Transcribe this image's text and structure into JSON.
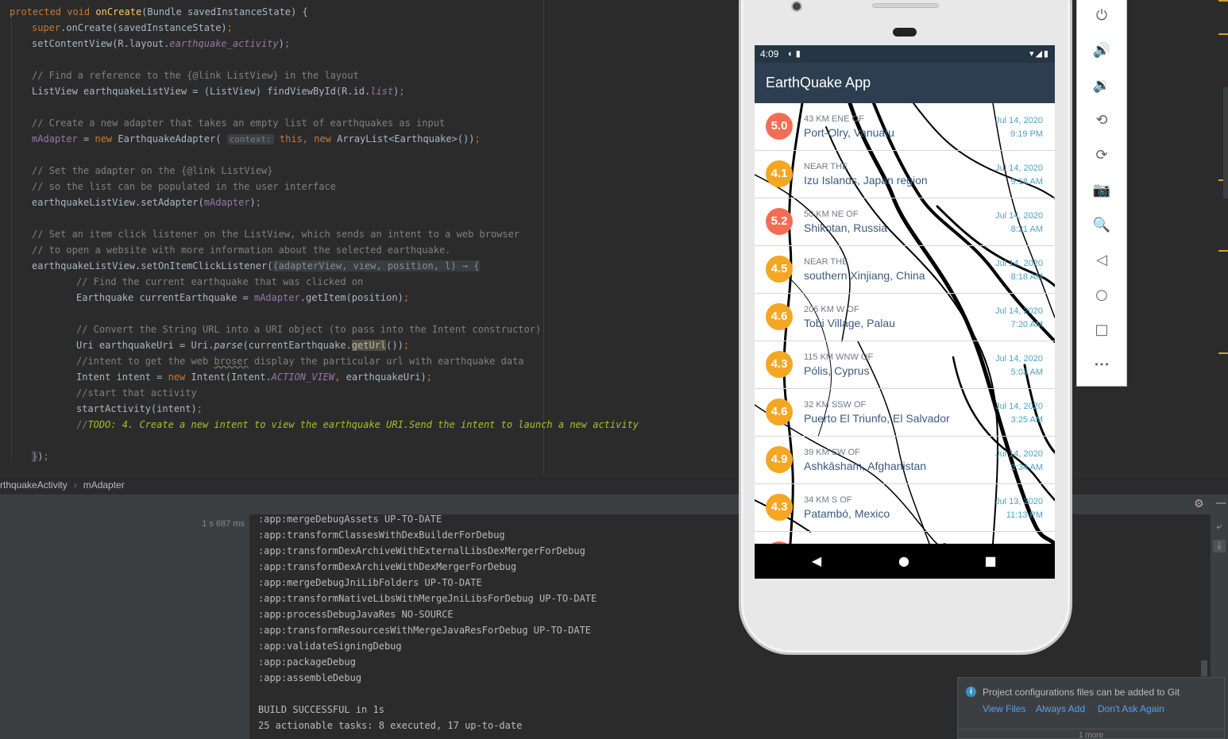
{
  "editor": {
    "lines": [
      {
        "indent": 0,
        "parts": [
          [
            "kw",
            "protected void "
          ],
          [
            "fn",
            "onCreate"
          ],
          [
            "",
            "(Bundle savedInstanceState) {"
          ]
        ]
      },
      {
        "indent": 1,
        "parts": [
          [
            "kw",
            "super"
          ],
          [
            "",
            ".onCreate(savedInstanceState)"
          ],
          [
            "kw",
            ";"
          ]
        ]
      },
      {
        "indent": 1,
        "parts": [
          [
            "",
            "setContentView(R.layout."
          ],
          [
            "fld ital",
            "earthquake_activity"
          ],
          [
            "",
            ")"
          ],
          [
            "kw",
            ";"
          ]
        ]
      },
      {
        "indent": 0,
        "parts": []
      },
      {
        "indent": 1,
        "parts": [
          [
            "cm",
            "// Find a reference to the {@link ListView} in the layout"
          ]
        ]
      },
      {
        "indent": 1,
        "parts": [
          [
            "",
            "ListView earthquakeListView = (ListView) findViewById(R.id."
          ],
          [
            "fld ital",
            "list"
          ],
          [
            "",
            ")"
          ],
          [
            "kw",
            ";"
          ]
        ]
      },
      {
        "indent": 0,
        "parts": []
      },
      {
        "indent": 1,
        "parts": [
          [
            "cm",
            "// Create a new adapter that takes an empty list of earthquakes as input"
          ]
        ]
      },
      {
        "indent": 1,
        "parts": [
          [
            "fld",
            "mAdapter"
          ],
          [
            "",
            " = "
          ],
          [
            "kw",
            "new "
          ],
          [
            "",
            "EarthquakeAdapter( "
          ],
          [
            "hint",
            "context:"
          ],
          [
            "kw",
            " this"
          ],
          [
            "kw",
            ", new "
          ],
          [
            "",
            "ArrayList<Earthquake>())"
          ],
          [
            "kw",
            ";"
          ]
        ]
      },
      {
        "indent": 0,
        "parts": []
      },
      {
        "indent": 1,
        "parts": [
          [
            "cm",
            "// Set the adapter on the {@link ListView}"
          ]
        ]
      },
      {
        "indent": 1,
        "parts": [
          [
            "cm",
            "// so the list can be populated in the user interface"
          ]
        ]
      },
      {
        "indent": 1,
        "parts": [
          [
            "",
            "earthquakeListView.setAdapter("
          ],
          [
            "fld",
            "mAdapter"
          ],
          [
            "",
            ")"
          ],
          [
            "kw",
            ";"
          ]
        ]
      },
      {
        "indent": 0,
        "parts": []
      },
      {
        "indent": 1,
        "parts": [
          [
            "cm",
            "// Set an item click listener on the ListView, which sends an intent to a web browser"
          ]
        ]
      },
      {
        "indent": 1,
        "parts": [
          [
            "cm",
            "// to open a website with more information about the selected earthquake."
          ]
        ]
      },
      {
        "indent": 1,
        "parts": [
          [
            "",
            "earthquakeListView.setOnItemClickListener("
          ],
          [
            "lam",
            "(adapterView, view, position, l) → {"
          ]
        ]
      },
      {
        "indent": 2,
        "parts": [
          [
            "cm",
            "// Find the current earthquake that was clicked on"
          ]
        ]
      },
      {
        "indent": 2,
        "parts": [
          [
            "",
            "Earthquake currentEarthquake = "
          ],
          [
            "fld",
            "mAdapter"
          ],
          [
            "",
            ".getItem(position)"
          ],
          [
            "kw",
            ";"
          ]
        ]
      },
      {
        "indent": 0,
        "parts": []
      },
      {
        "indent": 2,
        "parts": [
          [
            "cm",
            "// Convert the String URL into a URI object (to pass into the Intent constructor)"
          ]
        ]
      },
      {
        "indent": 2,
        "parts": [
          [
            "",
            "Uri earthquakeUri = Uri."
          ],
          [
            "ital",
            "parse"
          ],
          [
            "",
            "(currentEarthquake."
          ],
          [
            "hl",
            "getUrl"
          ],
          [
            "",
            "())"
          ],
          [
            "kw",
            ";"
          ]
        ]
      },
      {
        "indent": 2,
        "parts": [
          [
            "cm",
            "//intent to get the web "
          ],
          [
            "cm squig",
            "broser"
          ],
          [
            "cm",
            " display the particular url with earthquake data"
          ]
        ]
      },
      {
        "indent": 2,
        "parts": [
          [
            "",
            "Intent intent = "
          ],
          [
            "kw",
            "new "
          ],
          [
            "",
            "Intent(Intent."
          ],
          [
            "fld ital",
            "ACTION_VIEW"
          ],
          [
            "kw",
            ", "
          ],
          [
            "",
            "earthquakeUri)"
          ],
          [
            "kw",
            ";"
          ]
        ]
      },
      {
        "indent": 2,
        "parts": [
          [
            "cm",
            "//start that activity"
          ]
        ]
      },
      {
        "indent": 2,
        "parts": [
          [
            "",
            "startActivity(intent)"
          ],
          [
            "kw",
            ";"
          ]
        ]
      },
      {
        "indent": 2,
        "parts": [
          [
            "cm",
            "//"
          ],
          [
            "todo",
            "TODO: 4. Create a new intent to view the earthquake URI.Send the intent to launch a new activity"
          ]
        ]
      },
      {
        "indent": 0,
        "parts": []
      },
      {
        "indent": 1,
        "parts": [
          [
            "lam",
            "}"
          ],
          [
            "",
            ")"
          ],
          [
            "kw",
            ";"
          ]
        ]
      }
    ]
  },
  "breadcrumb": {
    "class_name": "rthquakeActivity",
    "separator": "›",
    "member": "mAdapter"
  },
  "build": {
    "elapsed": "1 s 687 ms",
    "output": [
      ":app:mergeDebugAssets UP-TO-DATE",
      ":app:transformClassesWithDexBuilderForDebug",
      ":app:transformDexArchiveWithExternalLibsDexMergerForDebug",
      ":app:transformDexArchiveWithDexMergerForDebug",
      ":app:mergeDebugJniLibFolders UP-TO-DATE",
      ":app:transformNativeLibsWithMergeJniLibsForDebug UP-TO-DATE",
      ":app:processDebugJavaRes NO-SOURCE",
      ":app:transformResourcesWithMergeJavaResForDebug UP-TO-DATE",
      ":app:validateSigningDebug",
      ":app:packageDebug",
      ":app:assembleDebug",
      "",
      "BUILD SUCCESSFUL in 1s",
      "25 actionable tasks: 8 executed, 17 up-to-date"
    ],
    "gear_icon": "⚙",
    "minimize_icon": "—"
  },
  "phone": {
    "status_time": "4:09",
    "status_left_icons": "◐ ▮",
    "status_right_icons": "▾◢▮",
    "app_title": "EarthQuake App",
    "quakes": [
      {
        "mag": "5.0",
        "color": "#f16e55",
        "offset": "43 KM ENE OF",
        "place": "Port-Olry, Vanuatu",
        "date": "Jul 14, 2020",
        "time": "9:19 PM"
      },
      {
        "mag": "4.1",
        "color": "#f5a623",
        "offset": "NEAR THE",
        "place": "Izu Islands, Japan region",
        "date": "Jul 14, 2020",
        "time": "9:18 AM"
      },
      {
        "mag": "5.2",
        "color": "#f16e55",
        "offset": "50 KM NE OF",
        "place": "Shikotan, Russia",
        "date": "Jul 14, 2020",
        "time": "8:21 AM"
      },
      {
        "mag": "4.5",
        "color": "#f5a623",
        "offset": "NEAR THE",
        "place": "southern Xinjiang, China",
        "date": "Jul 14, 2020",
        "time": "8:18 AM"
      },
      {
        "mag": "4.6",
        "color": "#f5a623",
        "offset": "206 KM W OF",
        "place": "Tobi Village, Palau",
        "date": "Jul 14, 2020",
        "time": "7:20 AM"
      },
      {
        "mag": "4.3",
        "color": "#f5a623",
        "offset": "115 KM WNW OF",
        "place": "Pólis, Cyprus",
        "date": "Jul 14, 2020",
        "time": "5:03 AM"
      },
      {
        "mag": "4.6",
        "color": "#f5a623",
        "offset": "32 KM SSW OF",
        "place": "Puerto El Triunfo, El Salvador",
        "date": "Jul 14, 2020",
        "time": "3:25 AM"
      },
      {
        "mag": "4.9",
        "color": "#f5a623",
        "offset": "39 KM SW OF",
        "place": "Ashkāsham, Afghanistan",
        "date": "Jul 14, 2020",
        "time": "2:34 AM"
      },
      {
        "mag": "4.3",
        "color": "#f5a623",
        "offset": "34 KM S OF",
        "place": "Patambó, Mexico",
        "date": "Jul 13, 2020",
        "time": "11:13 PM"
      }
    ],
    "nav": {
      "back": "◀",
      "home": "●",
      "recents": "■"
    }
  },
  "emulator_toolbar": [
    {
      "name": "power-icon",
      "glyph": "⏻"
    },
    {
      "name": "volume-up-icon",
      "glyph": "🔊"
    },
    {
      "name": "volume-down-icon",
      "glyph": "🔉"
    },
    {
      "name": "rotate-left-icon",
      "glyph": "⟲"
    },
    {
      "name": "rotate-right-icon",
      "glyph": "⟳"
    },
    {
      "name": "camera-icon",
      "glyph": "📷"
    },
    {
      "name": "zoom-icon",
      "glyph": "🔍"
    },
    {
      "name": "back-icon",
      "glyph": "◁"
    },
    {
      "name": "home-icon",
      "glyph": "○"
    },
    {
      "name": "overview-icon",
      "glyph": "□"
    },
    {
      "name": "more-icon",
      "glyph": "•••"
    }
  ],
  "notification": {
    "icon": "i",
    "message": "Project configurations files can be added to Git",
    "actions": [
      "View Files",
      "Always Add",
      "Don't Ask Again"
    ],
    "more": "1 more"
  }
}
